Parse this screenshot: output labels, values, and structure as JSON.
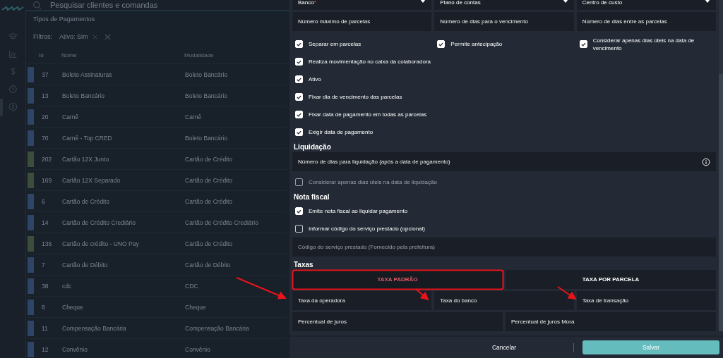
{
  "search": {
    "placeholder": "Pesquisar clientes e comandas"
  },
  "list": {
    "title": "Tipos de Pagamentos",
    "filters_label": "Filtros:",
    "filter_chip": "Ativo: Sim",
    "columns": [
      "Id",
      "Nome",
      "Modalidade"
    ],
    "rows": [
      {
        "color": "#2f4566",
        "id": "37",
        "name": "Boleto Assinaturas",
        "mode": "Boleto Bancário"
      },
      {
        "color": "#2f4566",
        "id": "13",
        "name": "Boleto Bancário",
        "mode": "Boleto Bancário"
      },
      {
        "color": "#2f4566",
        "id": "20",
        "name": "Carnê",
        "mode": "Carnê"
      },
      {
        "color": "#2f4566",
        "id": "70",
        "name": "Carnê - Top CRED",
        "mode": "Boleto Bancário"
      },
      {
        "color": "#3b4d3b",
        "id": "202",
        "name": "Cartão 12X Junto",
        "mode": "Cartão de Crédito"
      },
      {
        "color": "#3b4d3b",
        "id": "169",
        "name": "Cartão 12X Separado",
        "mode": "Cartão de Crédito"
      },
      {
        "color": "#2f4566",
        "id": "6",
        "name": "Cartão de Crédito",
        "mode": "Cartão de Crédito"
      },
      {
        "color": "#2f4566",
        "id": "14",
        "name": "Cartão de Crédito Crediário",
        "mode": "Cartão de Crédito Crediário"
      },
      {
        "color": "#3b4d3b",
        "id": "136",
        "name": "Cartão de crédito - UNO Pay",
        "mode": "Cartão de Crédito"
      },
      {
        "color": "#2f4566",
        "id": "7",
        "name": "Cartão de Débito",
        "mode": "Cartão de Débito"
      },
      {
        "color": "#2f4566",
        "id": "38",
        "name": "cdc",
        "mode": "CDC"
      },
      {
        "color": "#2f4566",
        "id": "8",
        "name": "Cheque",
        "mode": "Cheque"
      },
      {
        "color": "#2f4566",
        "id": "11",
        "name": "Compensação Bancária",
        "mode": "Compensação Bancária"
      },
      {
        "color": "#2f4566",
        "id": "12",
        "name": "Convênio",
        "mode": "Convênio"
      }
    ]
  },
  "form": {
    "selects": [
      {
        "label": "Banco",
        "required_mark": "*"
      },
      {
        "label": "Plano de contas"
      },
      {
        "label": "Centro de custo"
      }
    ],
    "fields": [
      {
        "placeholder": "Número máximo de parcelas"
      },
      {
        "placeholder": "Número de dias para o vencimento"
      },
      {
        "placeholder": "Número de dias entre as parcelas"
      }
    ],
    "checks_row": [
      {
        "label": "Separar em parcelas",
        "checked": true
      },
      {
        "label": "Permite antecipação",
        "checked": true
      },
      {
        "label": "Considerar apenas dias úteis na data de vencimento",
        "checked": true
      }
    ],
    "checks": [
      {
        "label": "Realiza movimentação no caixa da colaboradora",
        "checked": true
      },
      {
        "label": "Ativo",
        "checked": true
      },
      {
        "label": "Fixar dia de vencimento das parcelas",
        "checked": true
      },
      {
        "label": "Fixar data de pagamento em todas as parcelas",
        "checked": true
      },
      {
        "label": "Exigir data de pagamento",
        "checked": true
      }
    ],
    "liquidacao": {
      "title": "Liquidação",
      "field": {
        "placeholder": "Número de dias para liquidação (após a data de pagamento)"
      },
      "check": {
        "label": "Considerar apenas dias úteis na data de liquidação",
        "checked": false,
        "disabled": true
      }
    },
    "nota": {
      "title": "Nota fiscal",
      "checks": [
        {
          "label": "Emite nota fiscal ao liquidar pagamento",
          "checked": true
        },
        {
          "label": "Informar código do serviço prestado (opcional)",
          "checked": false
        }
      ],
      "field": {
        "placeholder": "Código do serviço prestado (Fornecido pela prefeitura)"
      }
    },
    "taxas": {
      "title": "Taxas",
      "tabs": [
        {
          "label": "TAXA PADRÃO",
          "selected": true
        },
        {
          "label": "TAXA POR PARCELA",
          "selected": false
        }
      ],
      "fields_row1": [
        {
          "placeholder": "Taxa da operadora"
        },
        {
          "placeholder": "Taxa do banco"
        },
        {
          "placeholder": "Taxa de transação"
        }
      ],
      "fields_row2": [
        {
          "placeholder": "Percentual de juros"
        },
        {
          "placeholder": "Percentual de juros Mora"
        }
      ]
    }
  },
  "footer": {
    "cancel": "Cancelar",
    "save": "Salvar"
  }
}
